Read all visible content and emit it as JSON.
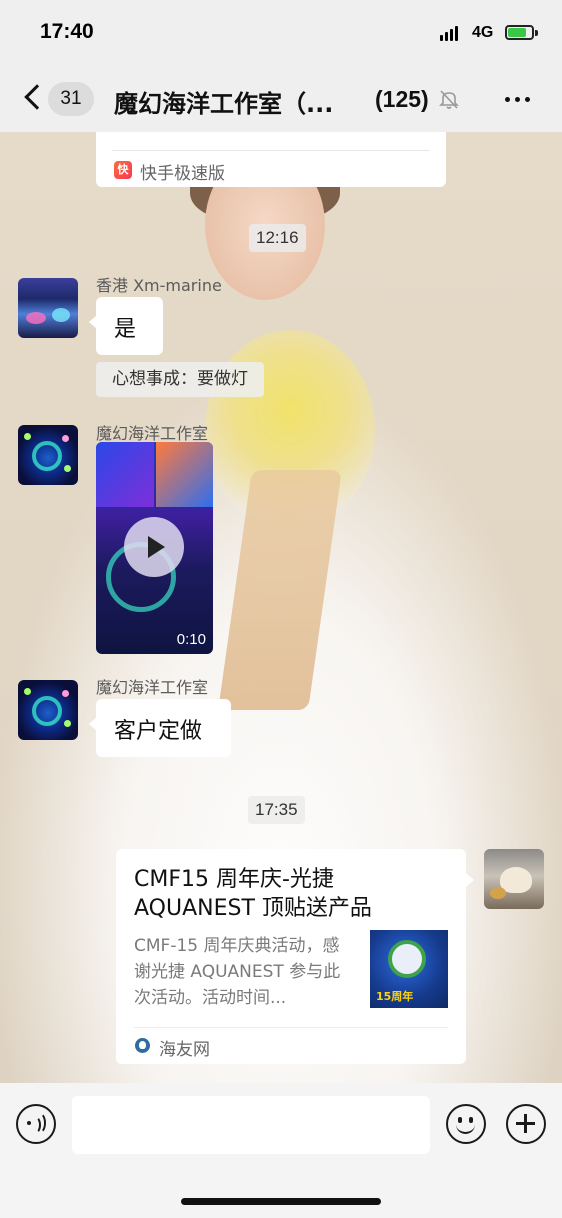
{
  "status_bar": {
    "time": "17:40",
    "network": "4G",
    "battery_icon": "battery-charging-icon"
  },
  "nav": {
    "back_icon": "chevron-left-icon",
    "unread_count": "31",
    "title": "魔幻海洋工作室（...",
    "member_count": "(125)",
    "mute_icon": "bell-muted-icon",
    "more_icon": "ellipsis-icon"
  },
  "messages": {
    "shared_card_top": {
      "source_icon": "kuaishou-icon",
      "source": "快手极速版"
    },
    "time_1": "12:16",
    "msg_1": {
      "sender": "香港 Xm-marine",
      "text": "是"
    },
    "quote_1": "心想事成：要做灯",
    "msg_2": {
      "sender": "魔幻海洋工作室",
      "video_duration": "0:10",
      "play_icon": "play-icon"
    },
    "msg_3": {
      "sender": "魔幻海洋工作室",
      "text": "客户定做"
    },
    "time_2": "17:35",
    "link_card": {
      "title": "CMF15 周年庆-光捷 AQUANEST 顶贴送产品",
      "description": "CMF-15 周年庆典活动，感谢光捷 AQUANEST 参与此次活动。活动时间...",
      "thumbnail_text": "15周年",
      "source_icon": "haiyouwang-icon",
      "source": "海友网"
    }
  },
  "input_bar": {
    "voice_icon": "voice-icon",
    "placeholder": "",
    "emoji_icon": "emoji-icon",
    "plus_icon": "plus-icon"
  },
  "colors": {
    "bubble": "#ffffff",
    "chrome": "#efefef",
    "battery_fill": "#38c746",
    "text": "#111111",
    "secondary_text": "#666666"
  }
}
